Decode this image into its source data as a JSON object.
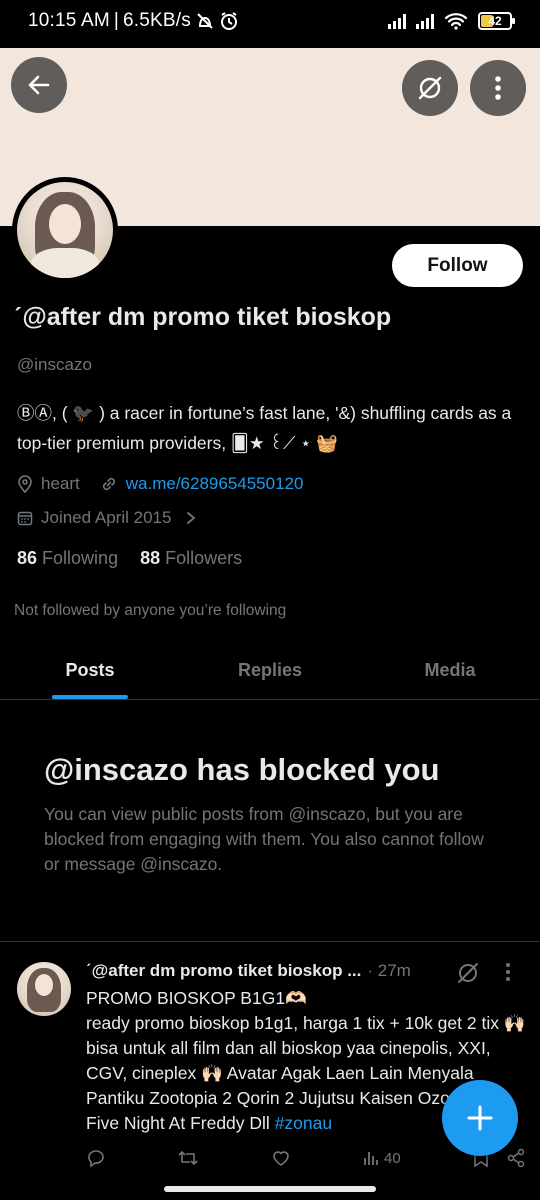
{
  "status_bar": {
    "time": "10:15 AM",
    "separator": "|",
    "speed": "6.5KB/s",
    "battery": "42"
  },
  "profile": {
    "display_name": "ˊ@after dm promo tiket bioskop",
    "handle": "@inscazo",
    "bio": "ⒷⒶ, ( 🐦‍⬛ ) a racer in fortune’s fast lane, '&) shuffling cards as a top-tier premium providers, 🂠★ ꒰⟋ ⋆ 🧺",
    "location": "heart",
    "website": "wa.me/6289654550120",
    "joined": "Joined April 2015",
    "following_count": "86",
    "following_label": "Following",
    "followers_count": "88",
    "followers_label": "Followers",
    "not_followed": "Not followed by anyone you’re following",
    "follow_button": "Follow"
  },
  "tabs": [
    {
      "label": "Posts",
      "active": true
    },
    {
      "label": "Replies",
      "active": false
    },
    {
      "label": "Media",
      "active": false
    }
  ],
  "blocked": {
    "title": "@inscazo has blocked you",
    "text": "You can view public posts from @inscazo, but you are blocked from engaging with them. You also cannot follow or message @inscazo."
  },
  "tweet": {
    "name": "ˊ@after dm promo tiket bioskop ...",
    "time": "· 27m",
    "line1": "PROMO BIOSKOP B1G1🫶🏻",
    "body": "ready promo bioskop b1g1, harga 1 tix + 10k get 2 tix 🙌🏻 bisa untuk all film dan all bioskop yaa cinepolis, XXI, CGV, cineplex 🙌🏻 Avatar Agak Laen Lain Menyala Pantiku Zootopia 2 Qorin 2 Jujutsu Kaisen Ozora Riba Five Night At Freddy Dll",
    "hashtag": "#zonau",
    "views": "40"
  },
  "colors": {
    "accent": "#1d9bf0",
    "muted": "#71767b",
    "banner": "#f3e6dc"
  }
}
